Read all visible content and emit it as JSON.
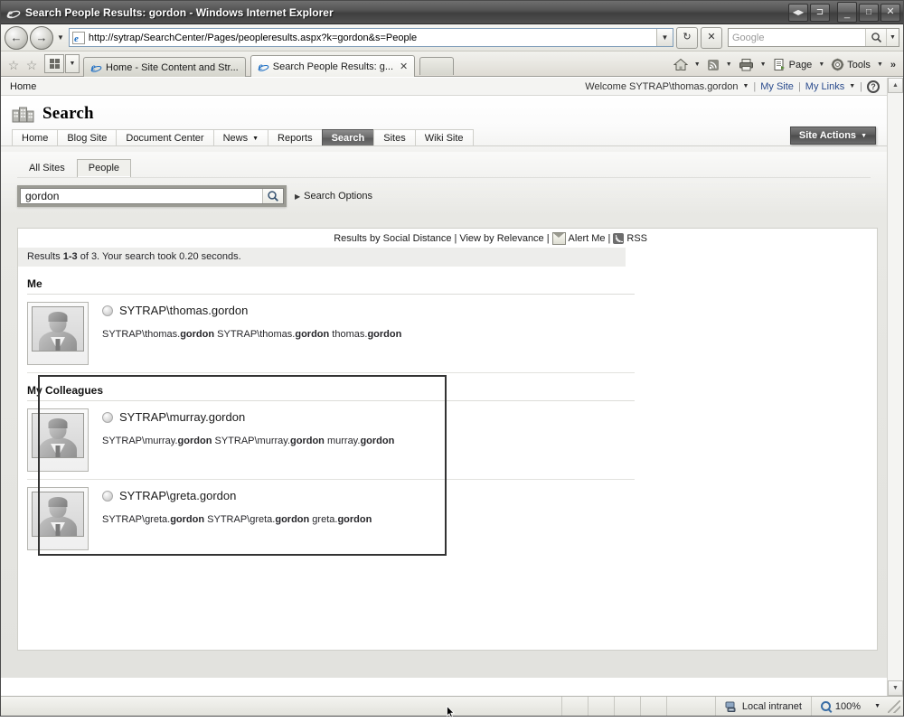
{
  "window": {
    "title": "Search People Results: gordon - Windows Internet Explorer",
    "app_icon": "ie-logo-icon",
    "controls": {
      "restore_down_left": "◀▶",
      "restore_window": "⊐",
      "minimize": "_",
      "maximize": "□",
      "close": "✕"
    }
  },
  "navbar": {
    "back_label": "←",
    "forward_label": "→",
    "history_caret": "▼",
    "url": "http://sytrap/SearchCenter/Pages/peopleresults.aspx?k=gordon&s=People",
    "address_dropdown": "▼",
    "refresh_label": "↻",
    "stop_label": "✕",
    "search_placeholder": "Google",
    "search_value": "",
    "search_provider_caret": "▼"
  },
  "tabbar": {
    "favorites_label": "☆",
    "add_favorites_label": "☆",
    "quick_tabs_label": "Quick Tabs",
    "quick_tabs_caret": "▼",
    "tabs": [
      {
        "label": "Home - Site Content and Str...",
        "active": false,
        "closable": false
      },
      {
        "label": "Search People Results: g...",
        "active": true,
        "close_label": "✕"
      }
    ],
    "new_tab_label": "",
    "commands": [
      {
        "label": "",
        "icon": "home-icon",
        "caret": "▼"
      },
      {
        "label": "",
        "icon": "feeds-icon",
        "caret": "▼"
      },
      {
        "label": "",
        "icon": "print-icon",
        "caret": "▼"
      },
      {
        "label": "Page",
        "icon": "page-icon",
        "caret": "▼"
      },
      {
        "label": "Tools",
        "icon": "gear-icon",
        "caret": "▼"
      }
    ],
    "overflow_label": "»"
  },
  "sharepoint": {
    "breadcrumb": "Home",
    "welcome": "Welcome SYTRAP\\thomas.gordon",
    "welcome_caret": "▼",
    "my_site": "My Site",
    "my_links": "My Links",
    "my_links_caret": "▼",
    "separator": "|",
    "help_label": "?",
    "site_title": "Search",
    "site_icon": "people-group-icon",
    "nav": [
      {
        "label": "Home",
        "selected": false,
        "caret": ""
      },
      {
        "label": "Blog Site",
        "selected": false,
        "caret": ""
      },
      {
        "label": "Document Center",
        "selected": false,
        "caret": ""
      },
      {
        "label": "News",
        "selected": false,
        "caret": "▼"
      },
      {
        "label": "Reports",
        "selected": false,
        "caret": ""
      },
      {
        "label": "Search",
        "selected": true,
        "caret": ""
      },
      {
        "label": "Sites",
        "selected": false,
        "caret": ""
      },
      {
        "label": "Wiki Site",
        "selected": false,
        "caret": ""
      }
    ],
    "site_actions": "Site Actions",
    "site_actions_caret": "▼"
  },
  "search": {
    "scopes": [
      {
        "label": "All Sites",
        "active": false
      },
      {
        "label": "People",
        "active": true
      }
    ],
    "query": "gordon",
    "placeholder": "",
    "go_icon": "search-icon",
    "options_label": "Search Options",
    "options_arrow": "▶"
  },
  "results": {
    "sort_by_social": "Results by Social Distance",
    "view_by_relevance": "View by Relevance",
    "alert_me": "Alert Me",
    "rss": "RSS",
    "pipe": "|",
    "summary_prefix": "Results ",
    "summary_range": "1-3",
    "summary_suffix": " of 3. Your search took 0.20 seconds.",
    "groups": [
      {
        "title": "Me",
        "highlighted": false,
        "people": [
          {
            "name": "SYTRAP\\thomas.gordon",
            "detail_pre1": "SYTRAP\\thomas.",
            "detail_bold1": "gordon",
            "detail_pre2": " SYTRAP\\thomas.",
            "detail_bold2": "gordon",
            "detail_pre3": " thomas.",
            "detail_bold3": "gordon"
          }
        ]
      },
      {
        "title": "My Colleagues",
        "highlighted": true,
        "people": [
          {
            "name": "SYTRAP\\murray.gordon",
            "detail_pre1": "SYTRAP\\murray.",
            "detail_bold1": "gordon",
            "detail_pre2": " SYTRAP\\murray.",
            "detail_bold2": "gordon",
            "detail_pre3": " murray.",
            "detail_bold3": "gordon"
          },
          {
            "name": "SYTRAP\\greta.gordon",
            "detail_pre1": "SYTRAP\\greta.",
            "detail_bold1": "gordon",
            "detail_pre2": " SYTRAP\\greta.",
            "detail_bold2": "gordon",
            "detail_pre3": " greta.",
            "detail_bold3": "gordon"
          }
        ]
      }
    ]
  },
  "statusbar": {
    "zone": "Local intranet",
    "zone_icon": "intranet-icon",
    "zoom": "100%",
    "zoom_caret": "▼"
  },
  "colors": {
    "accent": "#5a5a5a",
    "link": "#2a4b8d",
    "rss_orange": "#6d6d6d",
    "highlight_border": "#333333"
  }
}
